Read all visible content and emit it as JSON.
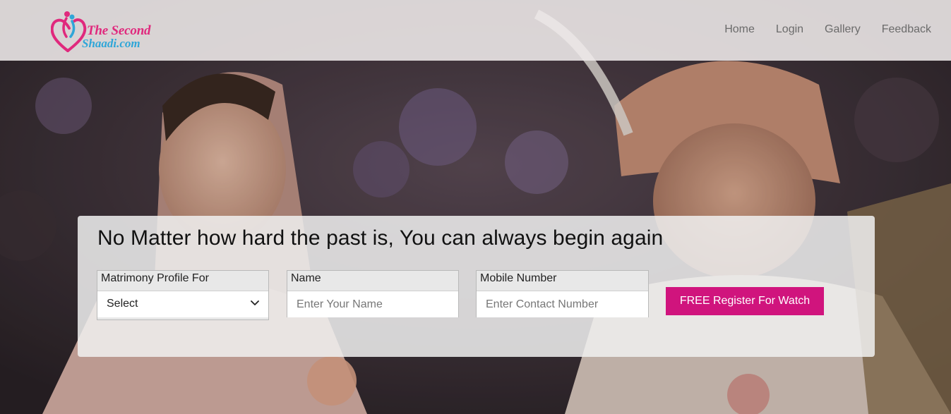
{
  "brand": {
    "line1": "The Second",
    "line2": "Shaadi.com",
    "colors": {
      "pink": "#e0297d",
      "blue": "#2fa6d8"
    }
  },
  "nav": {
    "items": [
      {
        "label": "Home"
      },
      {
        "label": "Login"
      },
      {
        "label": "Gallery"
      },
      {
        "label": "Feedback"
      }
    ]
  },
  "hero": {
    "headline": "No Matter how hard the past is, You can always begin again",
    "fields": {
      "profile": {
        "label": "Matrimony Profile For",
        "value": "Select"
      },
      "name": {
        "label": "Name",
        "placeholder": "Enter Your Name",
        "value": ""
      },
      "mobile": {
        "label": "Mobile Number",
        "placeholder": "Enter Contact Number",
        "value": ""
      }
    },
    "register_label": "FREE Register For Watch",
    "accent": "#d0147d"
  }
}
